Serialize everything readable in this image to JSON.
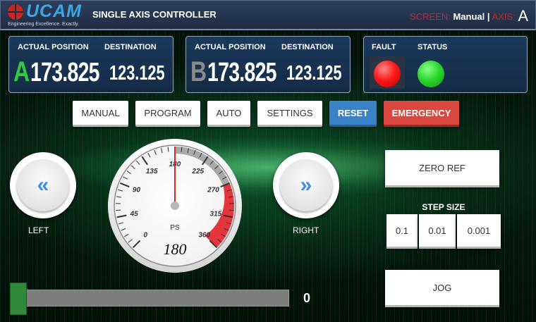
{
  "header": {
    "brand": "UCAM",
    "tagline": "Engineering Excellence. Exactly.",
    "title": "SINGLE AXIS CONTROLLER",
    "screen_label": "SCREEN:",
    "screen_value": "Manual",
    "separator": "|",
    "axis_label": "AXIS:",
    "axis_value": "A"
  },
  "axis_a": {
    "actual_label": "ACTUAL POSITION",
    "dest_label": "DESTINATION",
    "letter": "A",
    "actual": "173.825",
    "destination": "123.125",
    "letter_color": "#2ecc40"
  },
  "axis_b": {
    "actual_label": "ACTUAL POSITION",
    "dest_label": "DESTINATION",
    "letter": "B",
    "actual": "173.825",
    "destination": "123.125",
    "letter_color": "#8a8a8a"
  },
  "indicators": {
    "fault_label": "FAULT",
    "status_label": "STATUS",
    "fault_color": "#ff1a1a",
    "status_color": "#2ed72e"
  },
  "modes": [
    "MANUAL",
    "PROGRAM",
    "AUTO",
    "SETTINGS",
    "RESET",
    "EMERGENCY"
  ],
  "jog": {
    "left_label": "LEFT",
    "right_label": "RIGHT",
    "left_icon": "double-chevron-left-icon",
    "right_icon": "double-chevron-right-icon"
  },
  "gauge": {
    "ticks": [
      "0",
      "45",
      "90",
      "135",
      "180",
      "225",
      "270",
      "315",
      "360"
    ],
    "min": 0,
    "max": 360,
    "value": 180,
    "value_text": "180",
    "unit": "PS",
    "gray_band": [
      180,
      270
    ],
    "red_band": [
      270,
      360
    ]
  },
  "controls": {
    "zero_ref": "ZERO REF",
    "step_size_label": "STEP SIZE",
    "step_sizes": [
      "0.1",
      "0.01",
      "0.001"
    ],
    "jog": "JOG"
  },
  "slider": {
    "value": 0,
    "value_text": "0",
    "fraction": 0
  }
}
